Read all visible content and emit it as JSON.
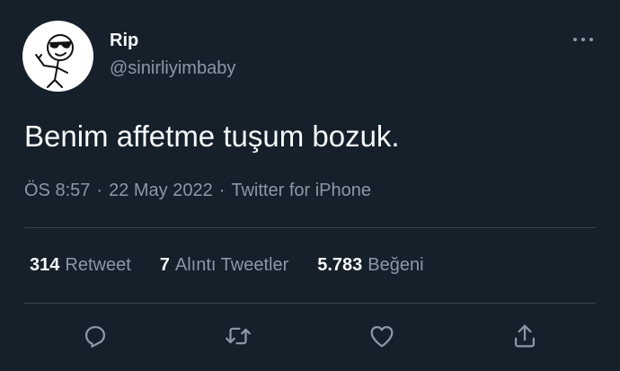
{
  "author": {
    "display_name": "Rip",
    "handle": "@sinirliyimbaby",
    "avatar_icon": "stick-figure-sunglasses-avatar"
  },
  "tweet": {
    "text": "Benim affetme tuşum bozuk.",
    "time": "ÖS 8:57",
    "separator": "·",
    "date": "22 May 2022",
    "source": "Twitter for iPhone"
  },
  "stats": {
    "retweets_count": "314",
    "retweets_label": "Retweet",
    "quotes_count": "7",
    "quotes_label": "Alıntı Tweetler",
    "likes_count": "5.783",
    "likes_label": "Beğeni"
  },
  "actions": {
    "reply_icon": "reply-icon",
    "retweet_icon": "retweet-icon",
    "like_icon": "heart-icon",
    "share_icon": "share-icon",
    "more_icon": "more-options-icon"
  },
  "colors": {
    "background": "#15202b",
    "text_primary": "#f7f9f9",
    "text_secondary": "#8b98a5",
    "divider": "#38444d"
  }
}
